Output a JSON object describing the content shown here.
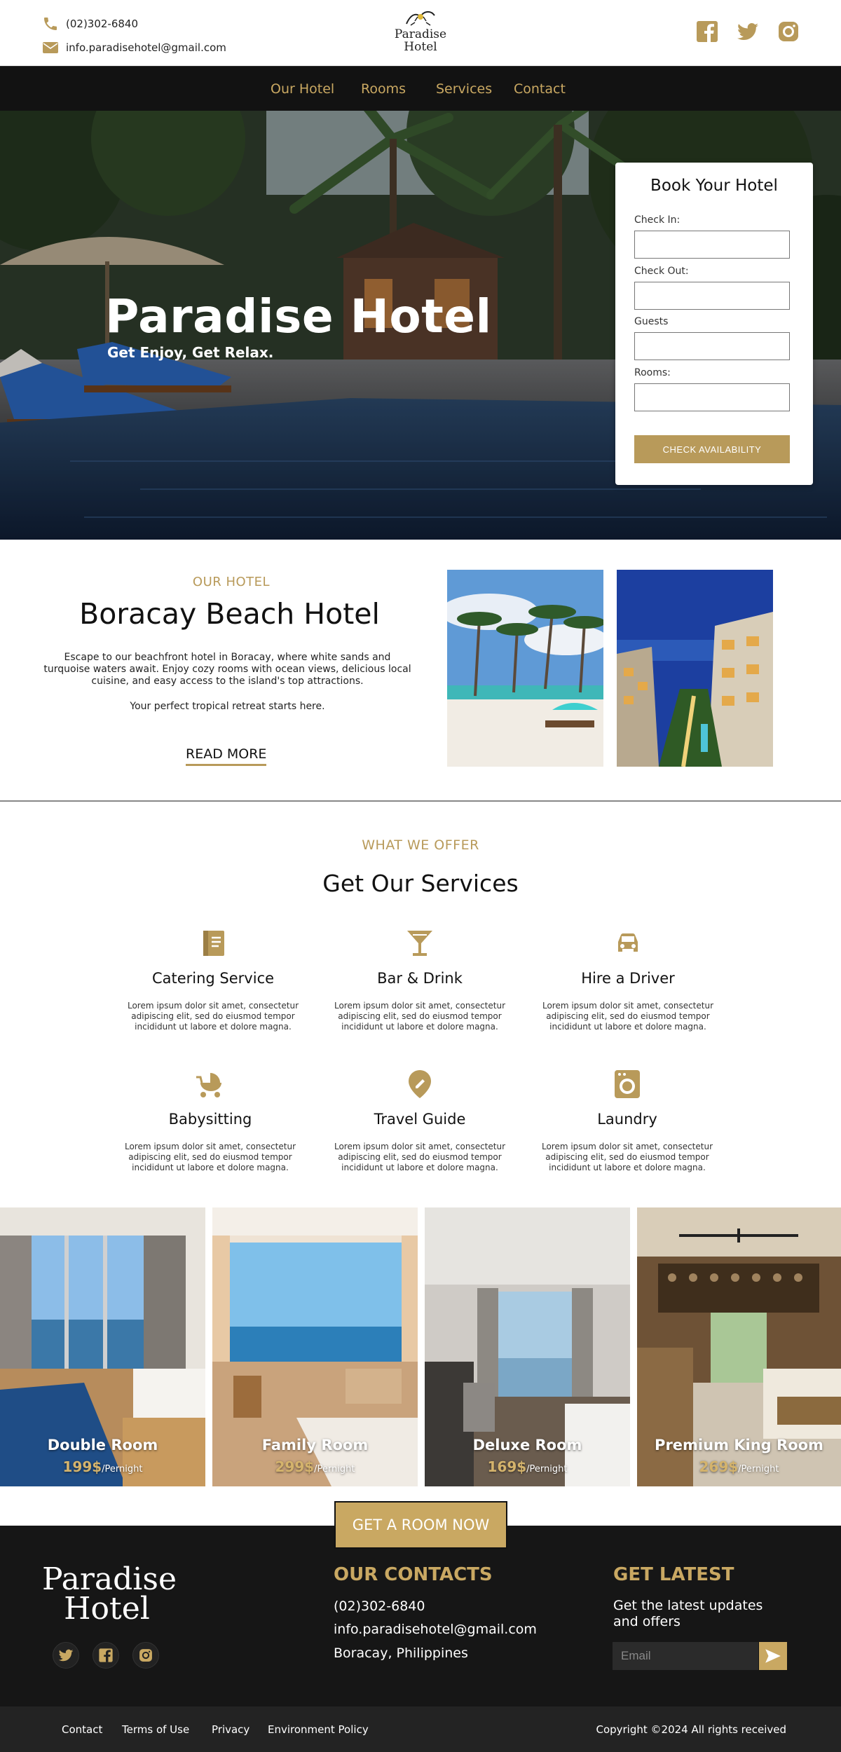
{
  "colors": {
    "accent": "#b89a5a",
    "accent_light": "#c9a862",
    "dark": "#121212"
  },
  "topbar": {
    "phone": "(02)302-6840",
    "email": "info.paradisehotel@gmail.com",
    "logo_line1": "Paradise",
    "logo_line2": "Hotel",
    "social": [
      "facebook-icon",
      "twitter-icon",
      "instagram-icon"
    ]
  },
  "nav": {
    "items": [
      "Our Hotel",
      "Rooms",
      "Services",
      "Contact"
    ]
  },
  "hero": {
    "title": "Paradise Hotel",
    "subtitle": "Get Enjoy, Get Relax."
  },
  "booking": {
    "title": "Book Your Hotel",
    "check_in_label": "Check In:",
    "check_in_value": "",
    "check_out_label": "Check Out:",
    "check_out_value": "",
    "guests_label": "Guests",
    "guests_value": "",
    "rooms_label": "Rooms:",
    "rooms_value": "",
    "button": "CHECK AVAILABILITY"
  },
  "about": {
    "kicker": "OUR HOTEL",
    "title": "Boracay Beach Hotel",
    "text": "Escape to our beachfront hotel in Boracay, where white sands and turquoise waters await. Enjoy cozy rooms with ocean views, delicious local cuisine, and easy access to the island's top attractions.",
    "text2": "Your perfect tropical retreat starts here.",
    "read_more": "READ MORE"
  },
  "services": {
    "kicker": "WHAT WE OFFER",
    "title": "Get Our Services",
    "items": [
      {
        "name": "Catering Service",
        "icon": "book-icon",
        "desc": "Lorem ipsum dolor sit amet, consectetur adipiscing elit, sed do eiusmod tempor incididunt ut labore et dolore magna."
      },
      {
        "name": "Bar & Drink",
        "icon": "cocktail-icon",
        "desc": "Lorem ipsum dolor sit amet, consectetur adipiscing elit, sed do eiusmod tempor incididunt ut labore et dolore magna."
      },
      {
        "name": "Hire a Driver",
        "icon": "car-icon",
        "desc": "Lorem ipsum dolor sit amet, consectetur adipiscing elit, sed do eiusmod tempor incididunt ut labore et dolore magna."
      },
      {
        "name": "Babysitting",
        "icon": "stroller-icon",
        "desc": "Lorem ipsum dolor sit amet, consectetur adipiscing elit, sed do eiusmod tempor incididunt ut labore et dolore magna."
      },
      {
        "name": "Travel Guide",
        "icon": "map-pin-icon",
        "desc": "Lorem ipsum dolor sit amet, consectetur adipiscing elit, sed do eiusmod tempor incididunt ut labore et dolore magna."
      },
      {
        "name": "Laundry",
        "icon": "washing-machine-icon",
        "desc": "Lorem ipsum dolor sit amet, consectetur adipiscing elit, sed do eiusmod tempor incididunt ut labore et dolore magna."
      }
    ]
  },
  "rooms": {
    "items": [
      {
        "name": "Double Room",
        "price": "199$",
        "unit": "/Pernight"
      },
      {
        "name": "Family Room",
        "price": "299$",
        "unit": "/Pernight"
      },
      {
        "name": "Deluxe Room",
        "price": "169$",
        "unit": "/Pernight"
      },
      {
        "name": "Premium King Room",
        "price": "269$",
        "unit": "/Pernight"
      }
    ],
    "cta": "GET A ROOM NOW"
  },
  "footer": {
    "logo_line1": "Paradise",
    "logo_line2": "Hotel",
    "contacts_title": "OUR CONTACTS",
    "phone": "(02)302-6840",
    "email": "info.paradisehotel@gmail.com",
    "address": "Boracay, Philippines",
    "latest_title": "GET LATEST",
    "latest_text": "Get the latest updates and offers",
    "email_placeholder": "Email",
    "social": [
      "twitter-icon",
      "facebook-icon",
      "instagram-icon"
    ]
  },
  "bottombar": {
    "links": [
      "Contact",
      "Terms of Use",
      "Privacy",
      "Environment Policy"
    ],
    "copyright": "Copyright ©2024 All rights received"
  }
}
